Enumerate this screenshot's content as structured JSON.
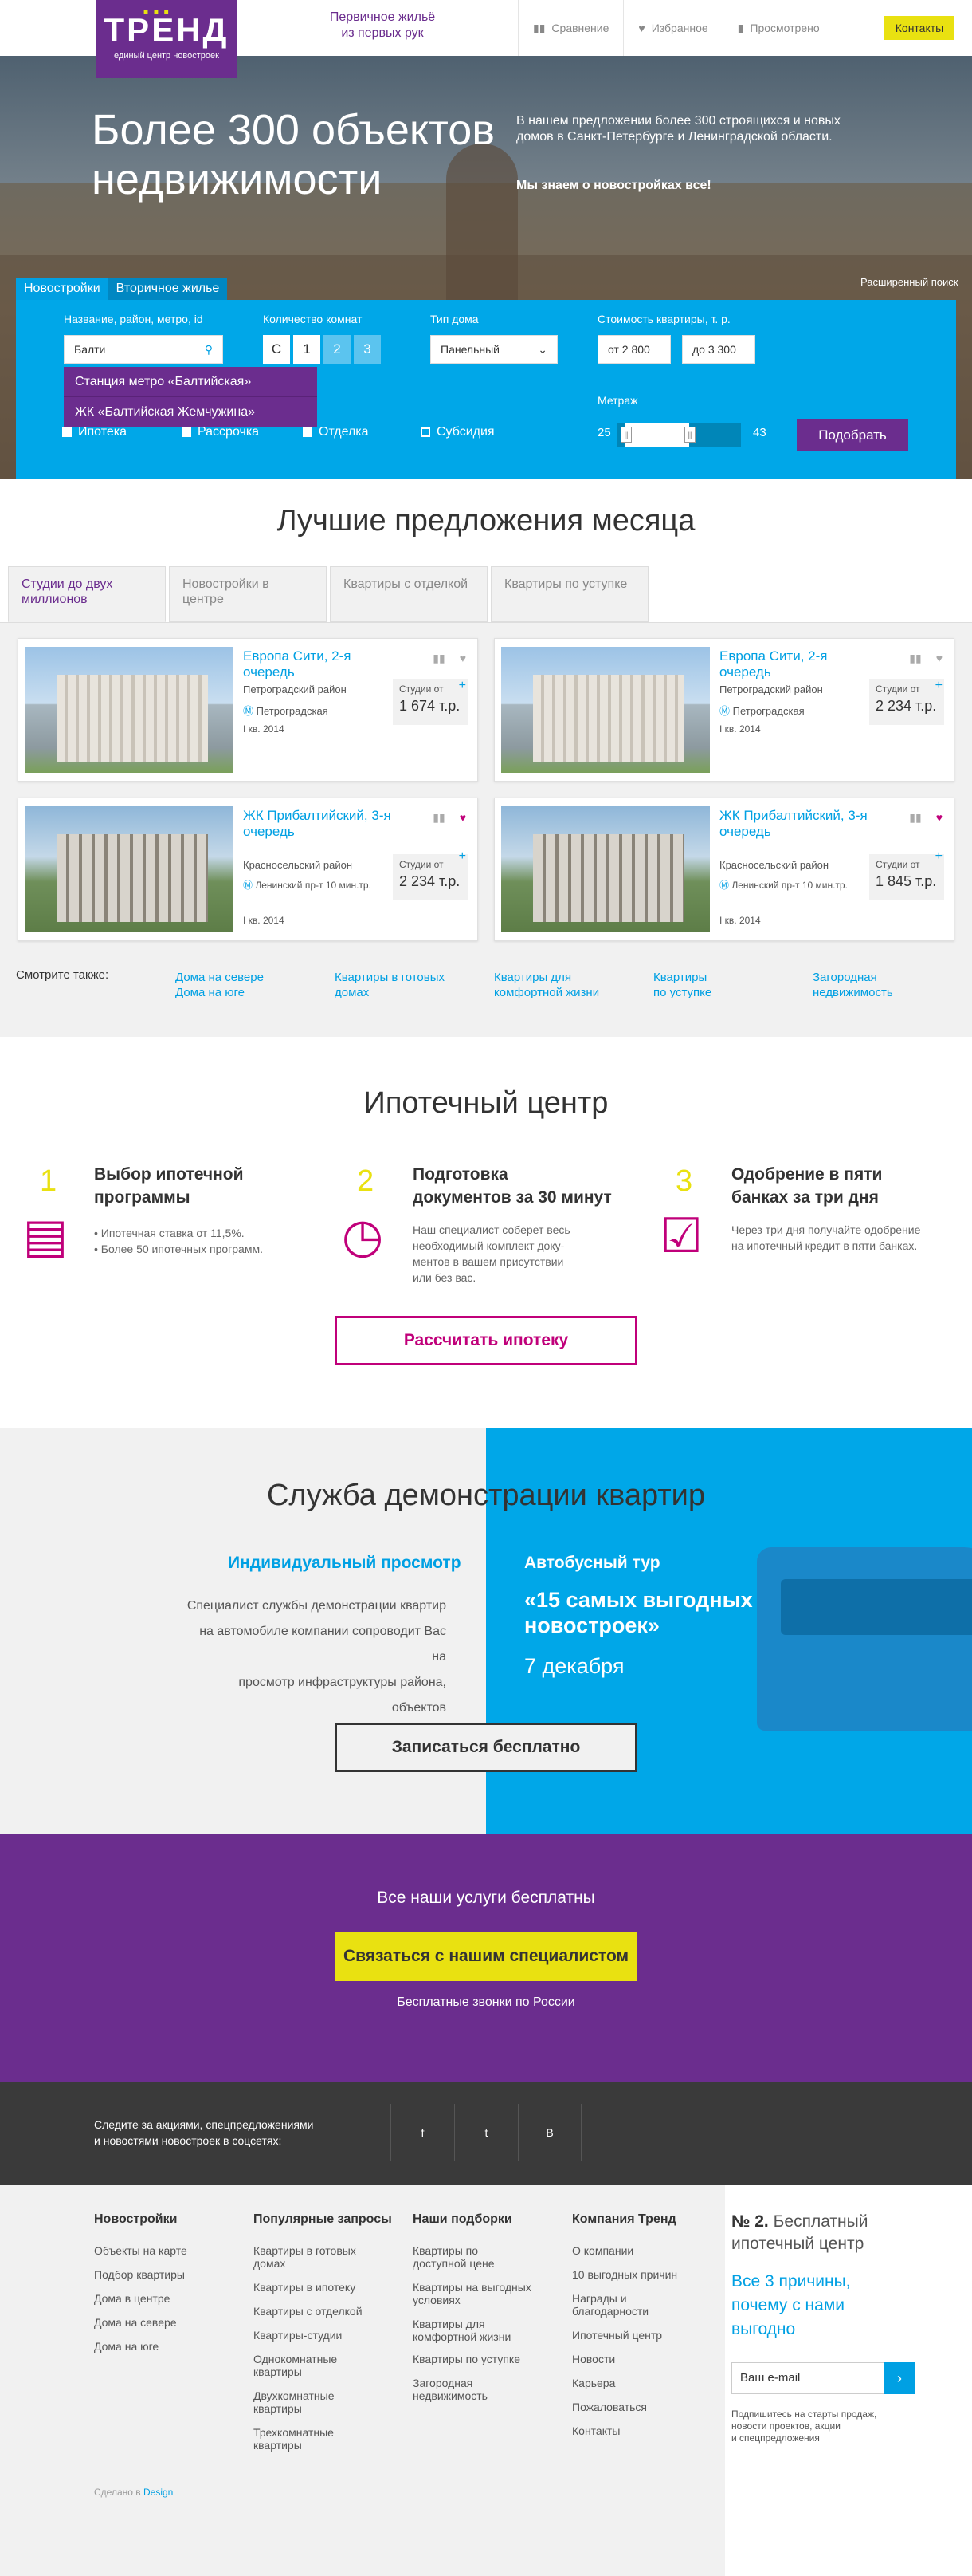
{
  "header": {
    "logo_title": "ТРЕНД",
    "logo_subtitle": "единый центр новостроек",
    "tagline": "Первичное жильё\nиз первых рук",
    "nav": [
      "Сравнение",
      "Избранное",
      "Просмотрено"
    ],
    "contacts": "Контакты"
  },
  "hero": {
    "title": "Более 300 объектов недвижимости",
    "text": "В нашем предложении более 300 строящихся и новых домов в Санкт-Петербурге и Ленинградской области.",
    "text2": "Мы знаем о новостройках все!",
    "advanced_search": "Расширенный поиск"
  },
  "search": {
    "tabs": [
      "Новостройки",
      "Вторичное жилье"
    ],
    "name_label": "Название, район, метро, id",
    "name_value": "Балти",
    "rooms_label": "Количество комнат",
    "rooms": [
      "С",
      "1",
      "2",
      "3"
    ],
    "house_label": "Тип дома",
    "house_value": "Панельный",
    "price_label": "Стоимость квартиры, т. р.",
    "price_from": "от 2 800",
    "price_to": "до 3 300",
    "suggestions": [
      "Станция метро «Балтийская»",
      "ЖК «Балтийская Жемчужина»"
    ],
    "checkboxes": [
      {
        "label": "Ипотека",
        "checked": true
      },
      {
        "label": "Рассрочка",
        "checked": true
      },
      {
        "label": "Отделка",
        "checked": true
      },
      {
        "label": "Субсидия",
        "checked": false
      }
    ],
    "area_label": "Метраж",
    "area_min": "25",
    "area_max": "43",
    "submit": "Подобрать"
  },
  "offers": {
    "title": "Лучшие предложения месяца",
    "tabs": [
      "Студии до двух миллионов",
      "Новостройки в центре",
      "Квартиры с отделкой",
      "Квартиры по уступке"
    ],
    "cards": [
      {
        "title": "Европа Сити, 2-я очередь",
        "district": "Петроградский район",
        "metro": "Петроградская",
        "date": "I кв. 2014",
        "price_label": "Студии от",
        "price": "1 674 т.р."
      },
      {
        "title": "Европа Сити, 2-я очередь",
        "district": "Петроградский район",
        "metro": "Петроградская",
        "date": "I кв. 2014",
        "price_label": "Студии от",
        "price": "2 234 т.р."
      },
      {
        "title": "ЖК Прибалтийский, 3-я очередь",
        "district": "Красносельский район",
        "metro": "Ленинский пр-т 10 мин.тр.",
        "date": "I кв. 2014",
        "price_label": "Студии от",
        "price": "2 234 т.р."
      },
      {
        "title": "ЖК Прибалтийский, 3-я очередь",
        "district": "Красносельский район",
        "metro": "Ленинский пр-т 10 мин.тр.",
        "date": "I кв. 2014",
        "price_label": "Студии от",
        "price": "1 845 т.р."
      }
    ],
    "see_also_label": "Смотрите также:",
    "see_also": [
      "Дома на севере\nДома на юге",
      "Квартиры в готовых\nдомах",
      "Квартиры для\nкомфортной жизни",
      "Квартиры\nпо уступке",
      "Загородная\nнедвижимость"
    ]
  },
  "mortgage": {
    "title": "Ипотечный центр",
    "steps": [
      {
        "num": "1",
        "title": "Выбор ипотечной\nпрограммы",
        "text": "• Ипотечная ставка от 11,5%.\n• Более 50 ипотечных программ."
      },
      {
        "num": "2",
        "title": "Подготовка\nдокументов за 30 минут",
        "text": "Наш специалист соберет весь\nнеобходимый комплект доку-\nментов в вашем присутствии\nили без вас."
      },
      {
        "num": "3",
        "title": "Одобрение в пяти\nбанках за три дня",
        "text": "Через три дня получайте одобрение\nна ипотечный кредит в пяти банках."
      }
    ],
    "button": "Рассчитать ипотеку"
  },
  "demo": {
    "title": "Служба демонстрации квартир",
    "left_title": "Индивидуальный просмотр",
    "left_text": "Специалист службы демонстрации квартир\nна автомобиле компании сопроводит Вас на\nпросмотр инфраструктуры района, объектов\nи квартир.",
    "right_title": "Автобусный тур",
    "right_big": "«15 самых выгодных\nновостроек»",
    "right_date": "7 декабря",
    "button": "Записаться бесплатно"
  },
  "free": {
    "title": "Все наши услуги бесплатны",
    "button": "Связаться с нашим специалистом",
    "note": "Бесплатные звонки по России"
  },
  "social": {
    "text": "Следите за акциями, спецпредложениями\nи новостями новостроек в соцсетях:",
    "items": [
      "f",
      "t",
      "В"
    ]
  },
  "footer": {
    "cols": [
      {
        "title": "Новостройки",
        "links": [
          "Объекты на карте",
          "Подбор квартиры",
          "Дома в центре",
          "Дома на севере",
          "Дома на юге"
        ]
      },
      {
        "title": "Популярные запросы",
        "links": [
          "Квартиры в готовых\nдомах",
          "Квартиры в ипотеку",
          "Квартиры с отделкой",
          "Квартиры-студии",
          "Однокомнатные\nквартиры",
          "Двухкомнатные\nквартиры",
          "Трехкомнатные\nквартиры"
        ]
      },
      {
        "title": "Наши подборки",
        "links": [
          "Квартиры по\nдоступной цене",
          "Квартиры на выгодных\nусловиях",
          "Квартиры для\nкомфортной жизни",
          "Квартиры по уступке",
          "Загородная\nнедвижимость"
        ]
      },
      {
        "title": "Компания Тренд",
        "links": [
          "О компании",
          "10 выгодных причин",
          "Награды и\nблагодарности",
          "Ипотечный центр",
          "Новости",
          "Карьера",
          "Пожаловаться",
          "Контакты"
        ]
      }
    ],
    "promo_num": "№ 2.",
    "promo_title": "Бесплатный\nипотечный центр",
    "promo_link": "Все 3 причины,\nпочему с нами\nвыгодно",
    "email_placeholder": "Ваш e-mail",
    "subscribe_note": "Подпишитесь на старты продаж,\nновости проектов, акции\nи спецпредложения",
    "made_by": "Сделано в",
    "made_by_link": "Design"
  }
}
